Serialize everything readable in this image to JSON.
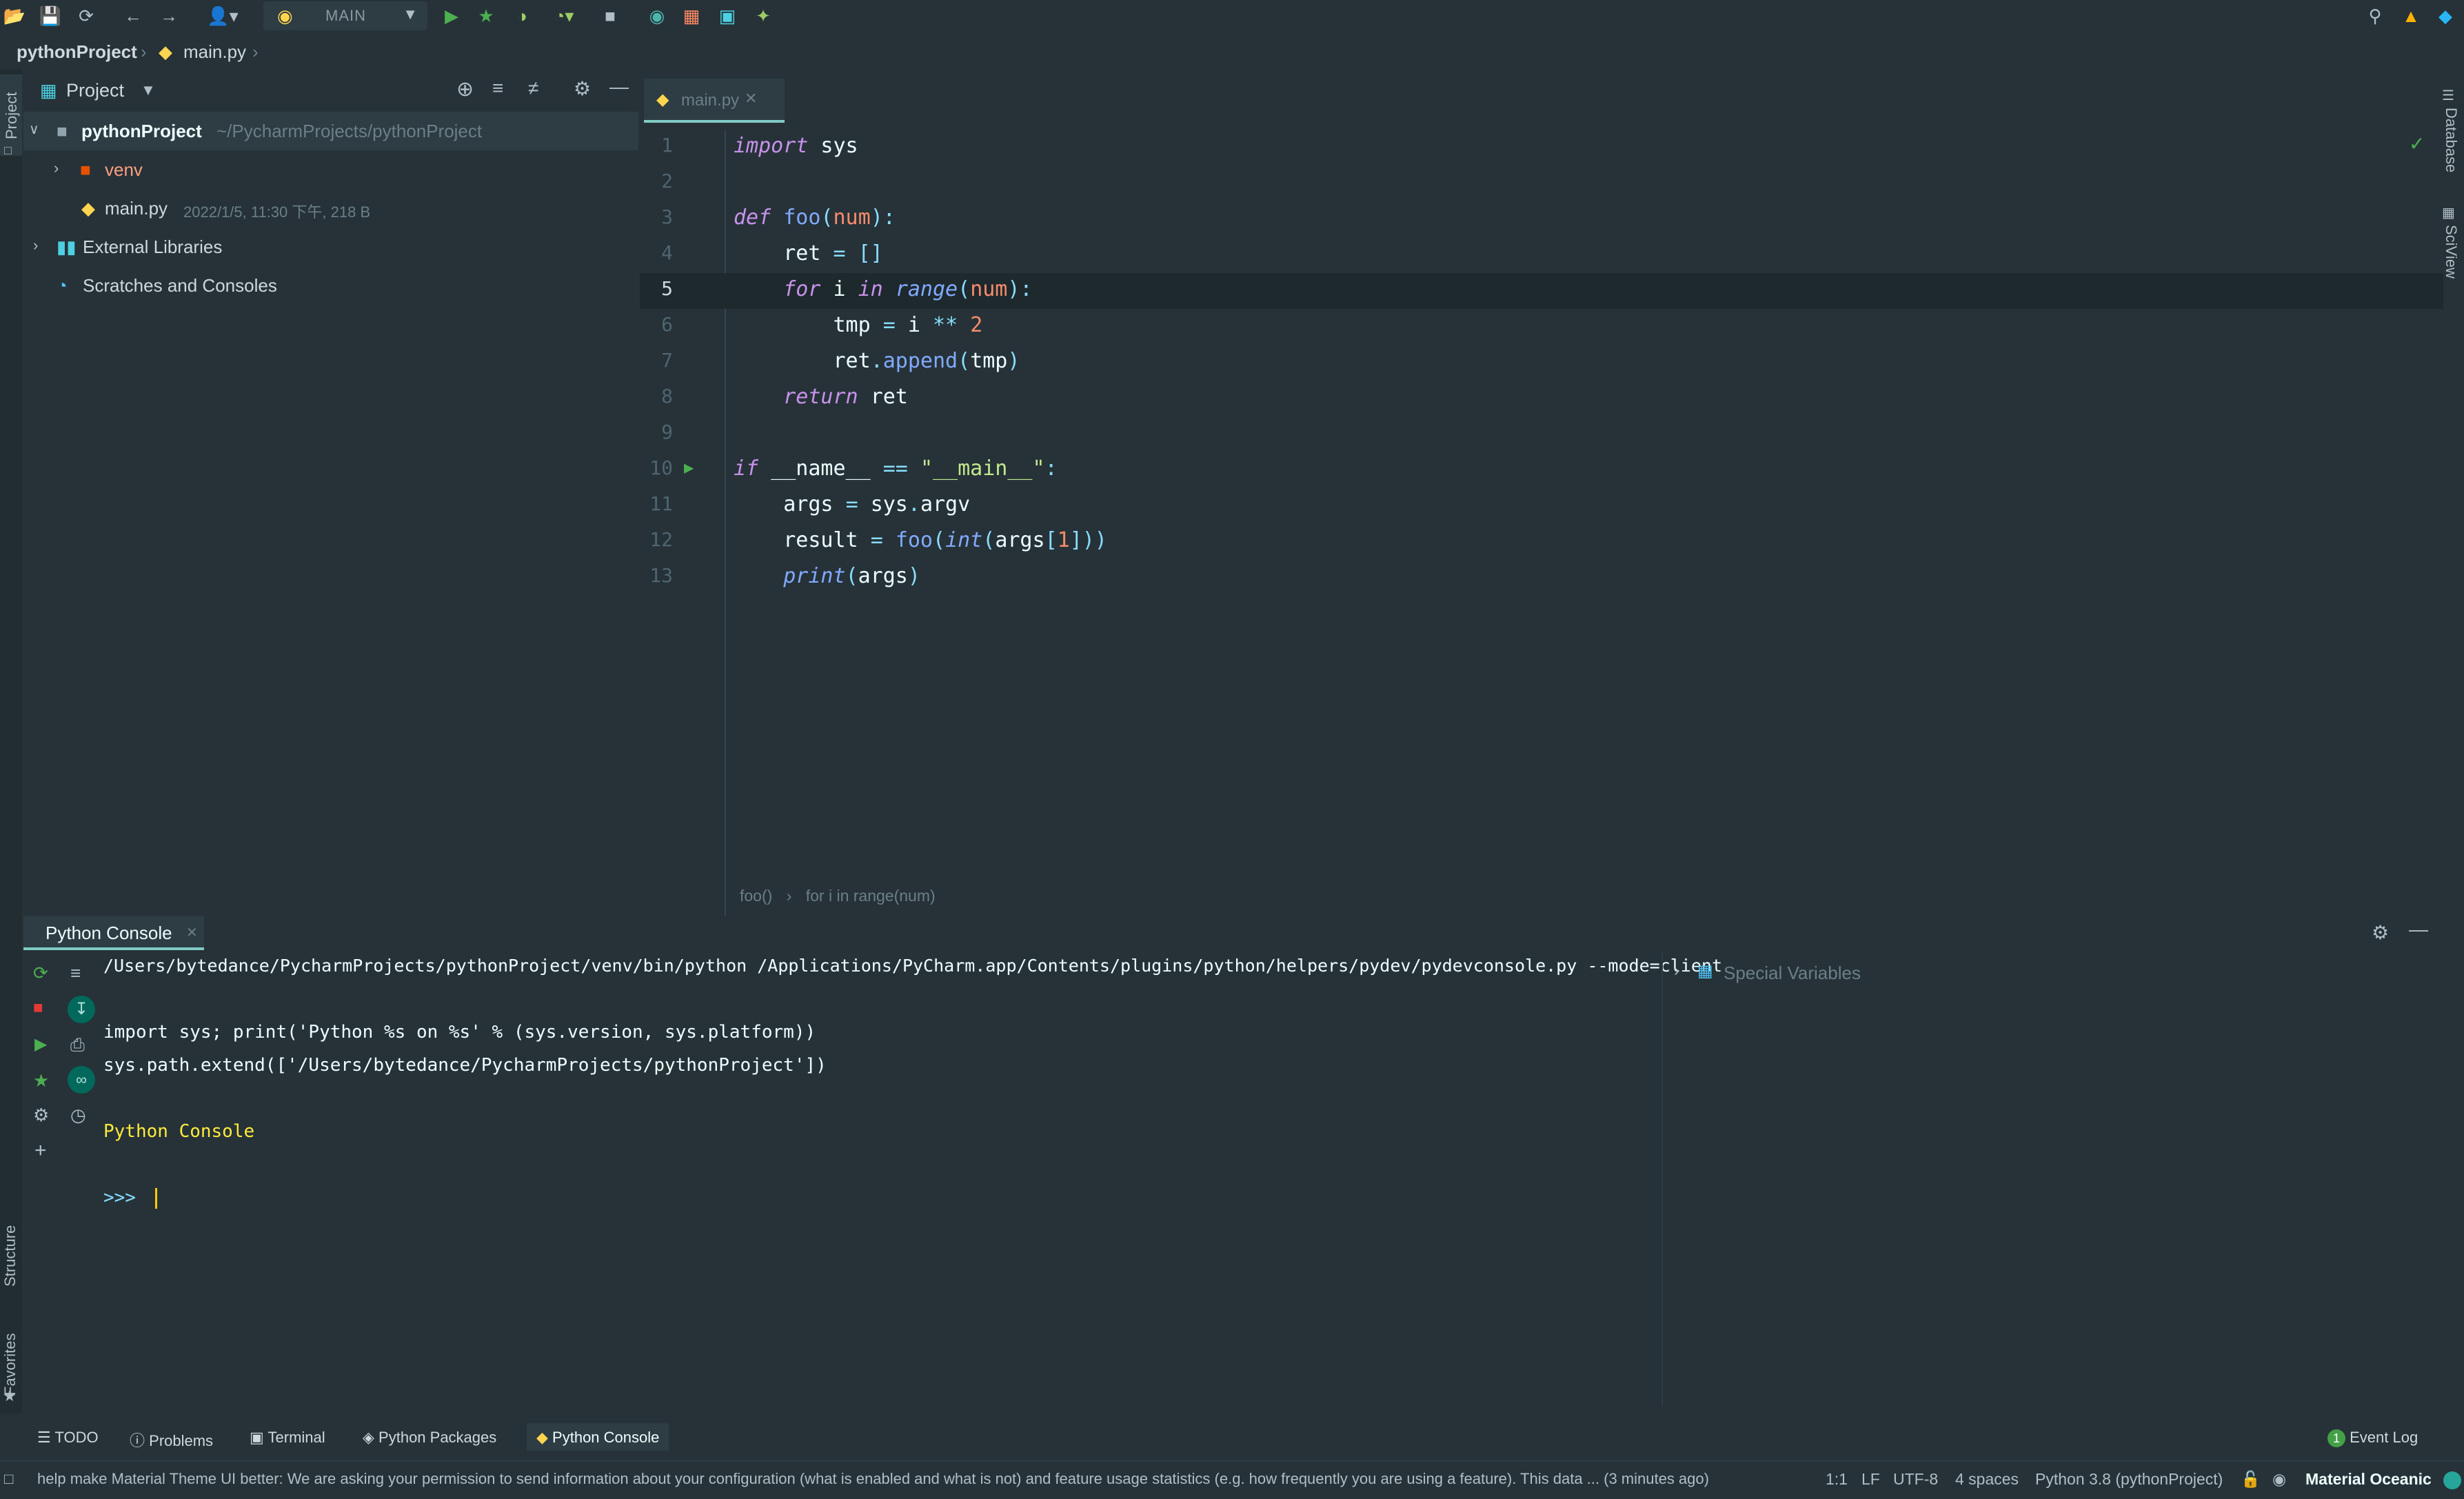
{
  "toolbar": {
    "run_config": "MAIN"
  },
  "breadcrumb": {
    "project": "pythonProject",
    "file": "main.py"
  },
  "left_strip": {
    "project": "Project",
    "structure": "Structure",
    "favorites": "Favorites"
  },
  "right_strip": {
    "database": "Database",
    "sciview": "SciView"
  },
  "project_panel": {
    "title": "Project",
    "tree": {
      "root_name": "pythonProject",
      "root_path": "~/PycharmProjects/pythonProject",
      "venv": "venv",
      "file_name": "main.py",
      "file_meta": "2022/1/5, 11:30 下午, 218 B",
      "ext_libs": "External Libraries",
      "scratches": "Scratches and Consoles"
    }
  },
  "editor": {
    "tab": "main.py",
    "line_numbers": [
      "1",
      "2",
      "3",
      "4",
      "5",
      "6",
      "7",
      "8",
      "9",
      "10",
      "11",
      "12",
      "13"
    ],
    "code": {
      "l1_kw": "import",
      "l1_rest": " sys",
      "l3_kw": "def",
      "l3_fn": "foo",
      "l3_param": "num",
      "l4_var": "ret",
      "l4_eq": "=",
      "l4_list": "[]",
      "l5_for": "for",
      "l5_i": " i ",
      "l5_in": "in",
      "l5_range": "range",
      "l5_param": "num",
      "l6_tmp": "tmp",
      "l6_eq": "=",
      "l6_i": "i",
      "l6_op": "**",
      "l6_num": "2",
      "l7_ret": "ret",
      "l7_append": "append",
      "l7_tmp": "tmp",
      "l8_kw": "return",
      "l8_rest": " ret",
      "l10_if": "if",
      "l10_name": " __name__ ",
      "l10_eq": "==",
      "l10_str": "\"__main__\"",
      "l11_args": "args",
      "l11_eq": "=",
      "l11_sys": "sys",
      "l11_argv": "argv",
      "l12_result": "result",
      "l12_eq": "=",
      "l12_foo": "foo",
      "l12_int": "int",
      "l12_args": "args",
      "l12_idx": "1",
      "l13_print": "print",
      "l13_args": "args"
    },
    "crumbs": {
      "fn": "foo()",
      "loop": "for i in range(num)"
    }
  },
  "console": {
    "title": "Python Console",
    "cmd_line": "/Users/bytedance/PycharmProjects/pythonProject/venv/bin/python /Applications/PyCharm.app/Contents/plugins/python/helpers/pydev/pydevconsole.py --mode=client",
    "import_line": "import sys; print('Python %s on %s' % (sys.version, sys.platform))",
    "path_line": "sys.path.extend(['/Users/bytedance/PycharmProjects/pythonProject'])",
    "banner": "Python Console",
    "prompt": ">>>",
    "special_vars": "Special Variables"
  },
  "tool_tabs": {
    "todo": "TODO",
    "problems": "Problems",
    "terminal": "Terminal",
    "packages": "Python Packages",
    "console": "Python Console",
    "event_log": "Event Log",
    "event_count": "1"
  },
  "statusbar": {
    "message": "help make Material Theme UI better: We are asking your permission to send information about your configuration (what is enabled and what is not) and feature usage statistics (e.g. how frequently you are using a feature). This data ... (3 minutes ago)",
    "position": "1:1",
    "line_sep": "LF",
    "encoding": "UTF-8",
    "indent": "4 spaces",
    "interpreter": "Python 3.8 (pythonProject)",
    "theme": "Material Oceanic"
  },
  "colors": {
    "background": "#263238",
    "accent": "#80cbc4",
    "keyword": "#c792ea",
    "function": "#82aaff",
    "number": "#f78c6c",
    "string": "#c3e88d",
    "console_banner": "#ffeb3b"
  }
}
